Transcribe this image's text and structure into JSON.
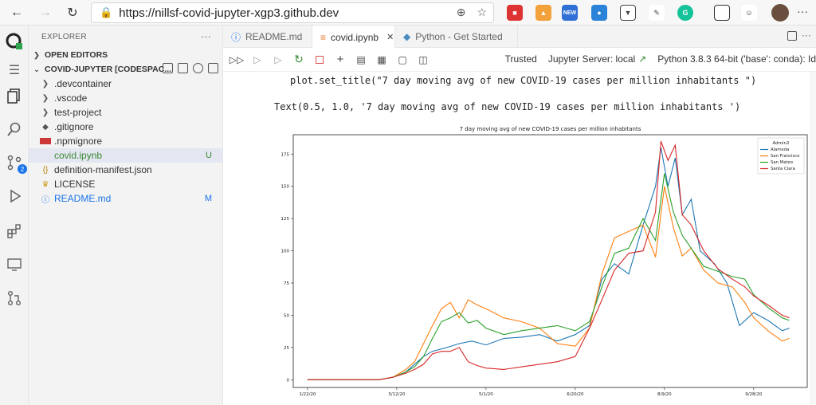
{
  "browser": {
    "url": "https://nillsf-covid-jupyter-xgp3.github.dev",
    "ext_new_label": "NEW"
  },
  "activity": {
    "source_control_badge": "2"
  },
  "sidebar": {
    "title": "EXPLORER",
    "more": "···",
    "open_editors": "OPEN EDITORS",
    "workspace": "COVID-JUPYTER [CODESPAC...",
    "items": [
      {
        "label": ".devcontainer",
        "kind": "folder"
      },
      {
        "label": ".vscode",
        "kind": "folder"
      },
      {
        "label": "test-project",
        "kind": "folder"
      },
      {
        "label": ".gitignore",
        "kind": "file"
      },
      {
        "label": ".npmignore",
        "kind": "file"
      },
      {
        "label": "covid.ipynb",
        "kind": "file",
        "status": "U"
      },
      {
        "label": "definition-manifest.json",
        "kind": "file"
      },
      {
        "label": "LICENSE",
        "kind": "file"
      },
      {
        "label": "README.md",
        "kind": "file",
        "status": "M"
      }
    ]
  },
  "tabs": [
    {
      "label": "README.md"
    },
    {
      "label": "covid.ipynb",
      "close": "✕"
    },
    {
      "label": "Python - Get Started"
    }
  ],
  "toolbar": {
    "trusted": "Trusted",
    "server": "Jupyter Server: local",
    "kernel": "Python 3.8.3 64-bit ('base': conda): Id"
  },
  "notebook": {
    "code": "plot.set_title(\"7 day moving avg of new COVID-19 cases per million inhabitants \")",
    "output_text": "Text(0.5, 1.0, '7 day moving avg of new COVID-19 cases per million inhabitants ')"
  },
  "chart_data": {
    "type": "line",
    "title": "7 day moving avg of new COVID-19 cases per million inhabitants",
    "xlabel": "",
    "ylabel": "",
    "x_ticks": [
      "1/22/20",
      "3/12/20",
      "5/1/20",
      "6/20/20",
      "8/9/20",
      "9/28/20"
    ],
    "x_tick_days": [
      0,
      50,
      100,
      150,
      200,
      250
    ],
    "y_ticks": [
      0,
      25,
      50,
      75,
      100,
      125,
      150,
      175
    ],
    "ylim": [
      -6,
      190
    ],
    "xlim": [
      -8,
      280
    ],
    "legend_title": "Admin2",
    "legend_position": "top-right",
    "series": [
      {
        "name": "Alameda",
        "color": "#1f77b4",
        "x": [
          0,
          20,
          40,
          48,
          55,
          60,
          65,
          70,
          78,
          85,
          92,
          100,
          110,
          120,
          130,
          140,
          150,
          158,
          165,
          172,
          180,
          188,
          195,
          198,
          202,
          206,
          210,
          215,
          220,
          228,
          235,
          242,
          250,
          258,
          266,
          270
        ],
        "y": [
          0,
          0,
          0,
          2,
          6,
          12,
          18,
          22,
          25,
          28,
          30,
          27,
          32,
          33,
          35,
          30,
          35,
          42,
          78,
          90,
          82,
          120,
          150,
          180,
          150,
          172,
          128,
          140,
          100,
          90,
          75,
          42,
          52,
          46,
          38,
          40
        ]
      },
      {
        "name": "San Francisco",
        "color": "#ff7f0e",
        "x": [
          0,
          20,
          40,
          48,
          55,
          60,
          65,
          70,
          75,
          80,
          85,
          90,
          95,
          100,
          110,
          120,
          130,
          140,
          150,
          158,
          165,
          172,
          180,
          188,
          195,
          200,
          205,
          210,
          215,
          222,
          230,
          238,
          245,
          250,
          258,
          266,
          270
        ],
        "y": [
          0,
          0,
          0,
          2,
          8,
          14,
          28,
          42,
          55,
          60,
          48,
          62,
          58,
          55,
          48,
          45,
          40,
          28,
          26,
          40,
          82,
          110,
          115,
          120,
          95,
          150,
          118,
          96,
          102,
          85,
          75,
          72,
          60,
          48,
          38,
          30,
          32
        ]
      },
      {
        "name": "San Mateo",
        "color": "#2ca02c",
        "x": [
          0,
          20,
          40,
          48,
          55,
          60,
          65,
          70,
          75,
          80,
          85,
          90,
          95,
          100,
          110,
          120,
          130,
          140,
          150,
          158,
          165,
          172,
          180,
          188,
          195,
          200,
          205,
          210,
          215,
          222,
          230,
          238,
          245,
          250,
          258,
          266,
          270
        ],
        "y": [
          0,
          0,
          0,
          2,
          6,
          10,
          18,
          32,
          45,
          48,
          52,
          44,
          46,
          40,
          35,
          38,
          40,
          42,
          38,
          45,
          72,
          98,
          102,
          125,
          108,
          160,
          130,
          112,
          102,
          88,
          84,
          80,
          78,
          66,
          56,
          48,
          46
        ]
      },
      {
        "name": "Santa Clara",
        "color": "#d62728",
        "x": [
          0,
          20,
          40,
          48,
          55,
          60,
          65,
          70,
          75,
          80,
          85,
          90,
          95,
          100,
          110,
          120,
          130,
          140,
          150,
          158,
          165,
          172,
          180,
          188,
          195,
          198,
          202,
          206,
          210,
          215,
          222,
          230,
          238,
          245,
          250,
          258,
          266,
          270
        ],
        "y": [
          0,
          0,
          0,
          2,
          5,
          8,
          12,
          20,
          22,
          22,
          25,
          14,
          11,
          9,
          8,
          10,
          12,
          14,
          18,
          40,
          62,
          85,
          98,
          100,
          130,
          185,
          170,
          182,
          128,
          120,
          100,
          86,
          78,
          72,
          65,
          58,
          50,
          48
        ]
      }
    ]
  }
}
